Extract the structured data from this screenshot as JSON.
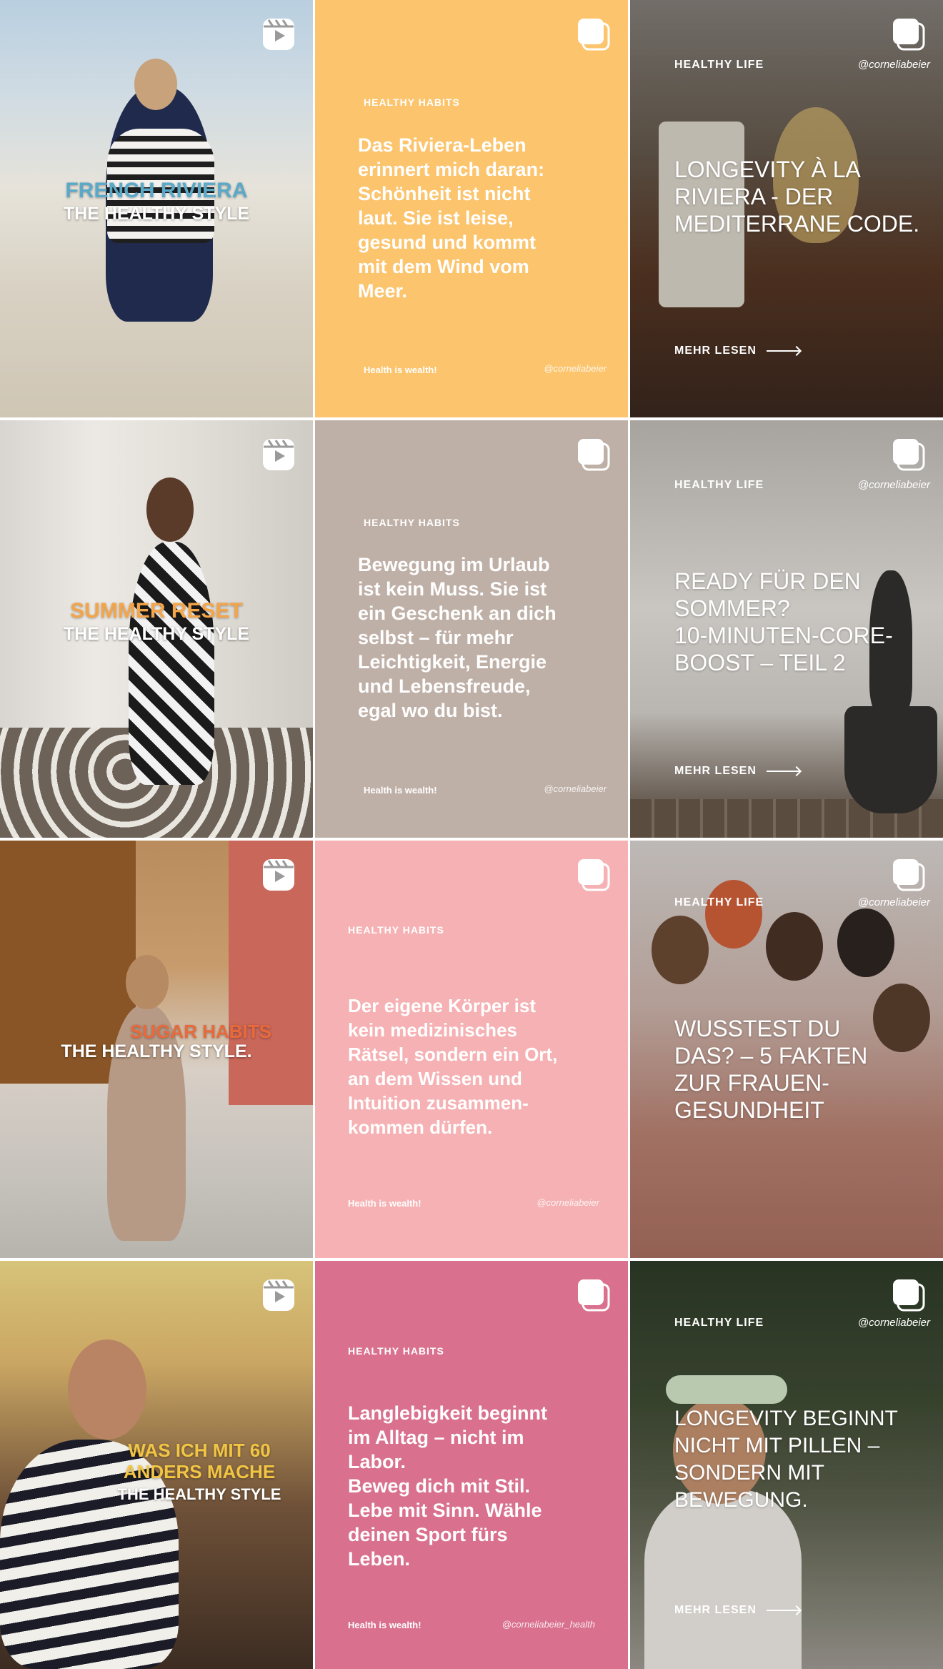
{
  "colors": {
    "card_yellow": "#fbc46d",
    "card_taupe": "#bfb0a7",
    "card_pink": "#f5b1b3",
    "card_rose": "#d9708e",
    "reel_blue": "#5aa9c9",
    "reel_orange": "#f3a54a",
    "reel_orange_red": "#e86a3c",
    "reel_yellow": "#f2c544"
  },
  "posts": [
    {
      "type": "reel",
      "icon": "reel-icon",
      "title": "FRENCH RIVIERA",
      "subtitle": "THE HEALTHY STYLE"
    },
    {
      "type": "carousel",
      "icon": "carousel-icon",
      "kicker": "HEALTHY HABITS",
      "body": "Das Riviera-Leben\nerinnert mich daran:\nSchönheit ist nicht\nlaut. Sie ist leise,\ngesund und kommt\nmit dem Wind vom\nMeer.",
      "footer": "Health is wealth!",
      "handle": "@corneliabeier"
    },
    {
      "type": "carousel",
      "icon": "carousel-icon",
      "kicker": "HEALTHY LIFE",
      "handle": "@corneliabeier",
      "title": "LONGEVITY À LA\nRIVIERA - DER\nMEDITERRANE CODE.",
      "more": "MEHR LESEN"
    },
    {
      "type": "reel",
      "icon": "reel-icon",
      "title": "SUMMER RESET",
      "subtitle": "THE HEALTHY STYLE"
    },
    {
      "type": "carousel",
      "icon": "carousel-icon",
      "kicker": "HEALTHY HABITS",
      "body": "Bewegung im Urlaub\nist kein Muss. Sie ist\nein Geschenk an dich\nselbst – für mehr\nLeichtigkeit, Energie\nund Lebensfreude,\negal wo du bist.",
      "footer": "Health is wealth!",
      "handle": "@corneliabeier"
    },
    {
      "type": "carousel",
      "icon": "carousel-icon",
      "kicker": "HEALTHY LIFE",
      "handle": "@corneliabeier",
      "title": "READY FÜR DEN\nSOMMER?\n10-MINUTEN-CORE-\nBOOST – TEIL 2",
      "more": "MEHR LESEN"
    },
    {
      "type": "reel",
      "icon": "reel-icon",
      "title": "SUGAR HABITS",
      "subtitle": "THE HEALTHY STYLE."
    },
    {
      "type": "carousel",
      "icon": "carousel-icon",
      "kicker": "HEALTHY HABITS",
      "body": "Der eigene Körper ist\nkein medizinisches\nRätsel, sondern ein Ort,\nan dem Wissen und\nIntuition zusammen-\nkommen dürfen.",
      "footer": "Health is wealth!",
      "handle": "@corneliabeier"
    },
    {
      "type": "carousel",
      "icon": "carousel-icon",
      "kicker": "HEALTHY LIFE",
      "handle": "@corneliabeier",
      "title": "WUSSTEST DU\nDAS? – 5 FAKTEN\nZUR FRAUEN-\nGESUNDHEIT"
    },
    {
      "type": "reel",
      "icon": "reel-icon",
      "title_line1": "WAS ICH MIT 60",
      "title_line2": "ANDERS MACHE",
      "subtitle": "THE HEALTHY STYLE"
    },
    {
      "type": "carousel",
      "icon": "carousel-icon",
      "kicker": "HEALTHY HABITS",
      "body": "Langlebigkeit beginnt\nim Alltag – nicht im\nLabor.\nBeweg dich mit Stil.\nLebe mit Sinn. Wähle\ndeinen Sport fürs\nLeben.",
      "footer": "Health is wealth!",
      "handle": "@corneliabeier_health"
    },
    {
      "type": "carousel",
      "icon": "carousel-icon",
      "kicker": "HEALTHY LIFE",
      "handle": "@corneliabeier",
      "title": "LONGEVITY BEGINNT\nNICHT MIT PILLEN –\nSONDERN MIT\nBEWEGUNG.",
      "more": "MEHR LESEN"
    }
  ]
}
